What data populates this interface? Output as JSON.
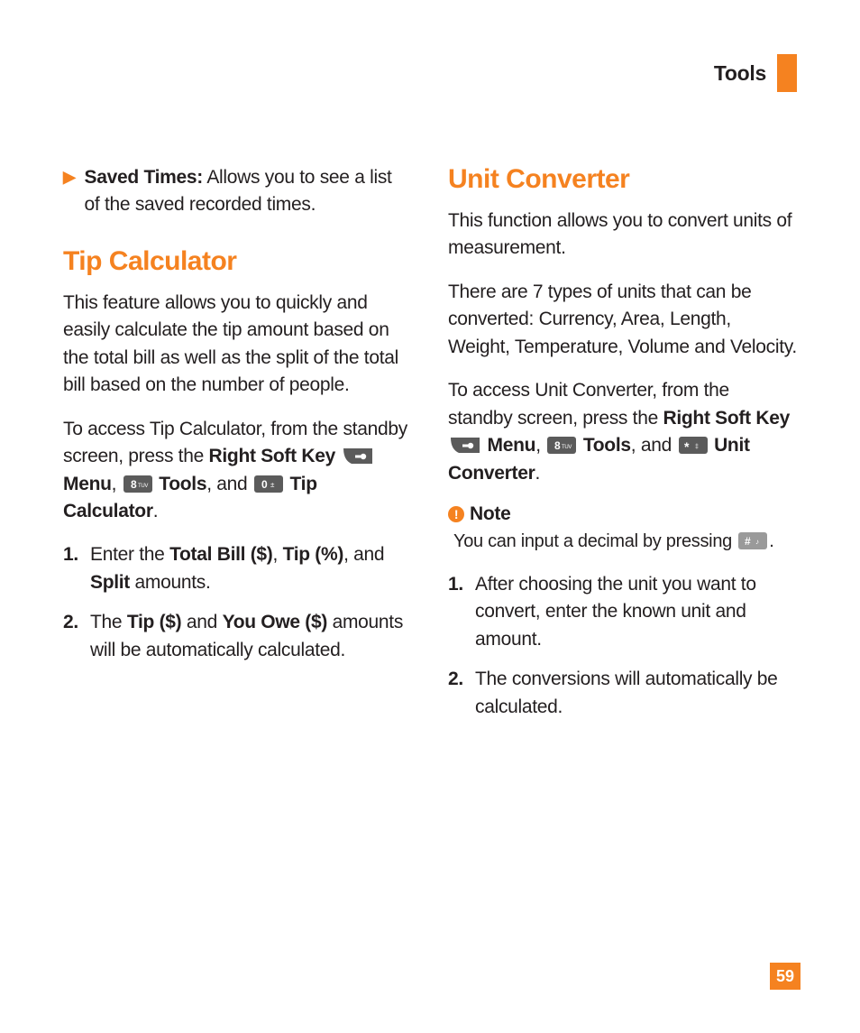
{
  "header": {
    "title": "Tools"
  },
  "left": {
    "bullet": {
      "label": "Saved Times:",
      "text": " Allows you to see a list of the saved recorded times."
    },
    "heading": "Tip Calculator",
    "p1": "This feature allows you to quickly and easily calculate the tip amount based on the total bill as well as the split of the total bill based on the number of people.",
    "p2a": "To access Tip Calculator, from the standby screen, press the ",
    "p2b": "Right Soft Key",
    "p2c": "Menu",
    "p2d": ", ",
    "p2e": "Tools",
    "p2f": ", and ",
    "p2g": "Tip Calculator",
    "p2h": ".",
    "steps": [
      {
        "num": "1.",
        "a": "Enter the ",
        "b": "Total Bill ($)",
        "c": ", ",
        "d": "Tip (%)",
        "e": ", and ",
        "f": "Split",
        "g": " amounts."
      },
      {
        "num": "2.",
        "a": "The ",
        "b": "Tip ($)",
        "c": " and ",
        "d": "You Owe ($)",
        "e": " amounts will be automatically calculated."
      }
    ],
    "key_labels": {
      "key8": "8 TUV",
      "key0": "0 ±"
    }
  },
  "right": {
    "heading": "Unit Converter",
    "p1": "This function allows you to convert units of measurement.",
    "p2": "There are 7 types of units that can be converted: Currency, Area, Length, Weight, Temperature, Volume and Velocity.",
    "p3a": "To access Unit Converter, from the standby screen, press the ",
    "p3b": "Right Soft Key",
    "p3c": "Menu",
    "p3d": ", ",
    "p3e": "Tools",
    "p3f": ", and ",
    "p3g": "Unit Converter",
    "p3h": ".",
    "note": {
      "heading": "Note",
      "body_a": "You can input a decimal by pressing ",
      "body_b": "."
    },
    "steps": [
      {
        "num": "1.",
        "text": "After choosing the unit you want to convert, enter the known unit and amount."
      },
      {
        "num": "2.",
        "text": "The conversions will automatically be calculated."
      }
    ],
    "key_labels": {
      "key8": "8 TUV",
      "keystar": "* ‡",
      "keyhash": "# ♪"
    }
  },
  "page_number": "59"
}
